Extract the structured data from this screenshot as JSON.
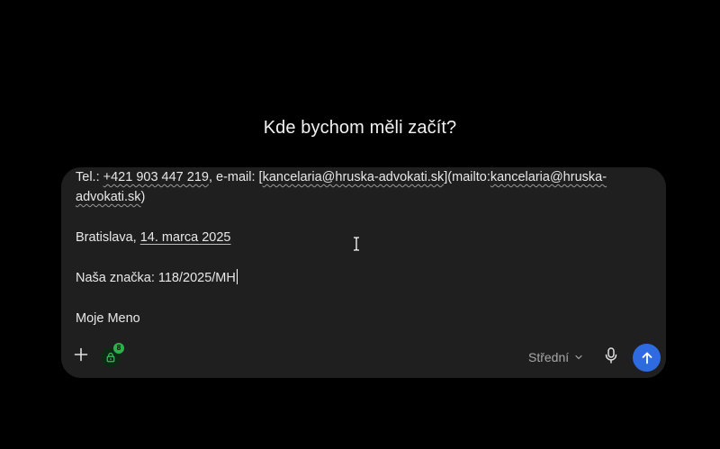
{
  "heading": "Kde bychom měli začít?",
  "editor": {
    "line1": {
      "prefix": "Tel.: ",
      "phone": "+421 903 447 219",
      "mid": ", e-mail: [",
      "email": "kancelaria@hruska-advokati.sk",
      "after": "](mailto:",
      "mailto_a": "kancelaria@hruska-",
      "mailto_b": "advokati.sk",
      "close": ")"
    },
    "place": "Bratislava, ",
    "date": "14. marca 2025",
    "reference": "Naša značka: 118/2025/MH",
    "signature": "Moje Meno"
  },
  "toolbar": {
    "plus_icon": "plus-icon",
    "lock_icon": "lock-icon",
    "badge_count": "8",
    "model_label": "Střední",
    "chevron_icon": "chevron-down-icon",
    "mic_icon": "microphone-icon",
    "send_icon": "arrow-up-icon"
  },
  "colors": {
    "background": "#000000",
    "composer": "#1f1f1f",
    "send": "#2f6be0",
    "badge": "#2bb24c"
  }
}
